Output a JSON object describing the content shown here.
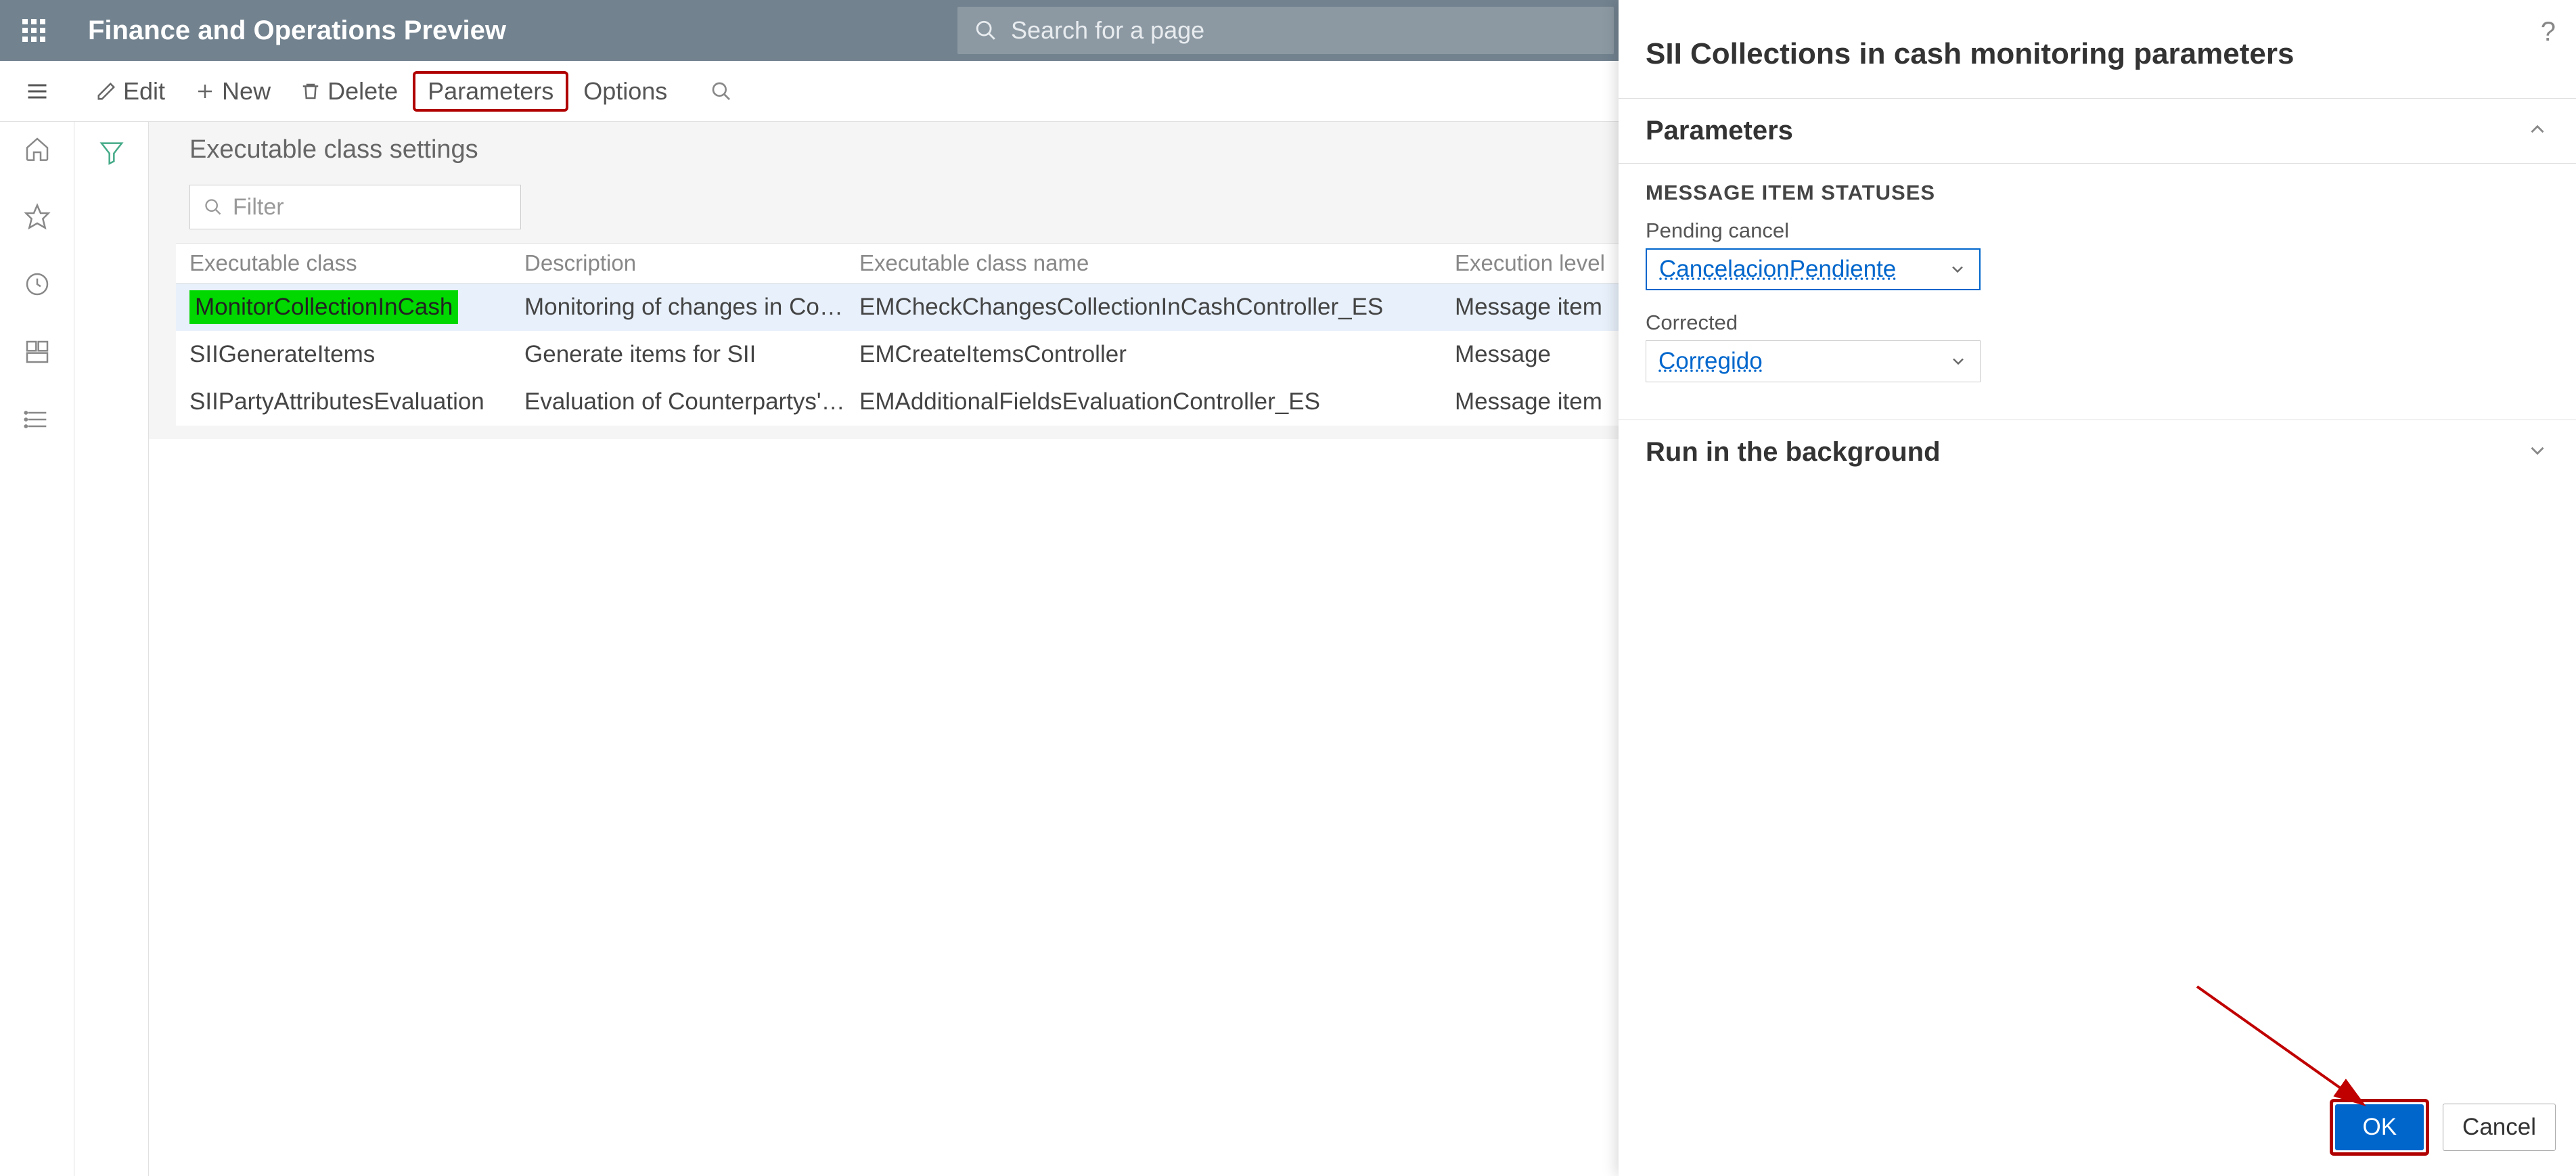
{
  "header": {
    "app_title": "Finance and Operations Preview",
    "search_placeholder": "Search for a page"
  },
  "actions": {
    "edit": "Edit",
    "new": "New",
    "delete": "Delete",
    "parameters": "Parameters",
    "options": "Options"
  },
  "main": {
    "page_title": "Executable class settings",
    "filter_placeholder": "Filter",
    "columns": {
      "class": "Executable class",
      "description": "Description",
      "class_name": "Executable class name",
      "level": "Execution level"
    },
    "rows": [
      {
        "class": "MonitorCollectionInCash",
        "description": "Monitoring of changes in Collec...",
        "class_name": "EMCheckChangesCollectionInCashController_ES",
        "level": "Message item",
        "selected": true,
        "highlighted": true
      },
      {
        "class": "SIIGenerateItems",
        "description": "Generate items for SII",
        "class_name": "EMCreateItemsController",
        "level": "Message",
        "selected": false,
        "highlighted": false
      },
      {
        "class": "SIIPartyAttributesEvaluation",
        "description": "Evaluation of Counterpartys' attr...",
        "class_name": "EMAdditionalFieldsEvaluationController_ES",
        "level": "Message item",
        "selected": false,
        "highlighted": false
      }
    ]
  },
  "panel": {
    "title": "SII Collections in cash monitoring parameters",
    "section_parameters": "Parameters",
    "subsection_statuses": "MESSAGE ITEM STATUSES",
    "field_pending": "Pending cancel",
    "value_pending": "CancelacionPendiente",
    "field_corrected": "Corrected",
    "value_corrected": "Corregido",
    "section_background": "Run in the background",
    "btn_ok": "OK",
    "btn_cancel": "Cancel"
  }
}
